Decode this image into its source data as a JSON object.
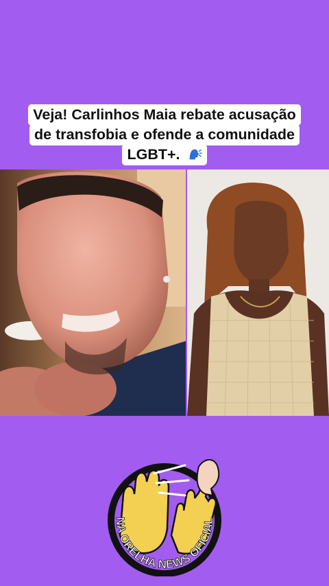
{
  "caption": {
    "line1": "Veja! Carlinhos Maia rebate acusação",
    "line2": "de transfobia e ofende a comunidade",
    "line3": "LGBT+.",
    "emoji": "speaking-head-emoji"
  },
  "photos": {
    "left": "man-speaking-photo",
    "right": "woman-portrait-photo"
  },
  "logo": {
    "text": "NA ORELHA NEWS OFICIAL",
    "icon": "ear-hands-whisper-logo"
  },
  "colors": {
    "background": "#a25cf0",
    "caption_bg": "#ffffff",
    "logo_ring": "#111111",
    "logo_fill": "#a25cf0",
    "hand_fill": "#f3cf52"
  }
}
